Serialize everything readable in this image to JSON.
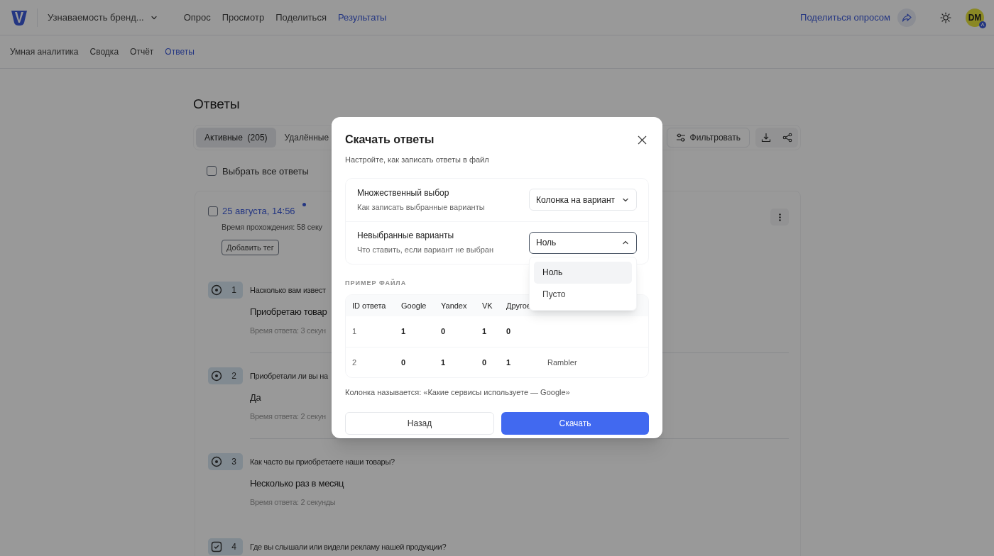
{
  "header": {
    "survey_title": "Узнаваемость бренд...",
    "nav": [
      {
        "label": "Опрос",
        "selected": false
      },
      {
        "label": "Просмотр",
        "selected": false
      },
      {
        "label": "Поделиться",
        "selected": false
      },
      {
        "label": "Результаты",
        "selected": true
      }
    ],
    "share_link": "Поделиться опросом",
    "avatar": "DM"
  },
  "subnav": [
    {
      "label": "Умная аналитика",
      "selected": false
    },
    {
      "label": "Сводка",
      "selected": false
    },
    {
      "label": "Отчёт",
      "selected": false
    },
    {
      "label": "Ответы",
      "selected": true
    }
  ],
  "page": {
    "title": "Ответы",
    "tabs": [
      {
        "label": "Активные  (205)",
        "selected": true
      },
      {
        "label": "Удалённые",
        "selected": false
      }
    ],
    "filter_button": "Фильтровать",
    "select_all": {
      "label": "Выбрать все ответы",
      "checked": false
    }
  },
  "response": {
    "date": "25 августа, 14:56",
    "unread": true,
    "checked": false,
    "duration": "Время прохождения: 58 секу",
    "tag_button": "Добавить тег",
    "answers": [
      {
        "kind": "radio",
        "number": "1",
        "question": "Насколько вам извест",
        "answer": "Приобретаю товар",
        "time": "Время ответа: 3 секун"
      },
      {
        "kind": "radio",
        "number": "2",
        "question": "Приобретали ли вы на",
        "answer": "Да",
        "time": "Время ответа: 2 секун"
      },
      {
        "kind": "radio",
        "number": "3",
        "question": "Как часто вы приобретаете наши товары?",
        "answer": "Несколько раз в месяц",
        "time": "Время ответа: 2 секунды"
      },
      {
        "kind": "checkbox",
        "number": "4",
        "question": "Где вы слышали или видели рекламу нашей продукции?"
      }
    ]
  },
  "dialog": {
    "title": "Скачать ответы",
    "subtitle": "Настройте, как записать ответы в файл",
    "settings": [
      {
        "label": "Множественный выбор",
        "hint": "Как записать выбранные варианты",
        "value": "Колонка на вариант",
        "open": false
      },
      {
        "label": "Невыбранные варианты",
        "hint": "Что ставить, если вариант не выбран",
        "value": "Ноль",
        "open": true,
        "options": [
          {
            "label": "Ноль",
            "selected": true
          },
          {
            "label": "Пусто",
            "selected": false
          }
        ]
      }
    ],
    "section_label": "ПРИМЕР ФАЙЛА",
    "table": {
      "columns": [
        "ID ответа",
        "Google",
        "Yandex",
        "VK",
        "Другое"
      ],
      "rows": [
        [
          "1",
          "1",
          "0",
          "1",
          "0"
        ],
        [
          "2",
          "0",
          "1",
          "0",
          "1",
          "Rambler"
        ]
      ]
    },
    "note": "Колонка называется: «Какие сервисы используете — Google»",
    "back_button": "Назад",
    "download_button": "Скачать"
  }
}
